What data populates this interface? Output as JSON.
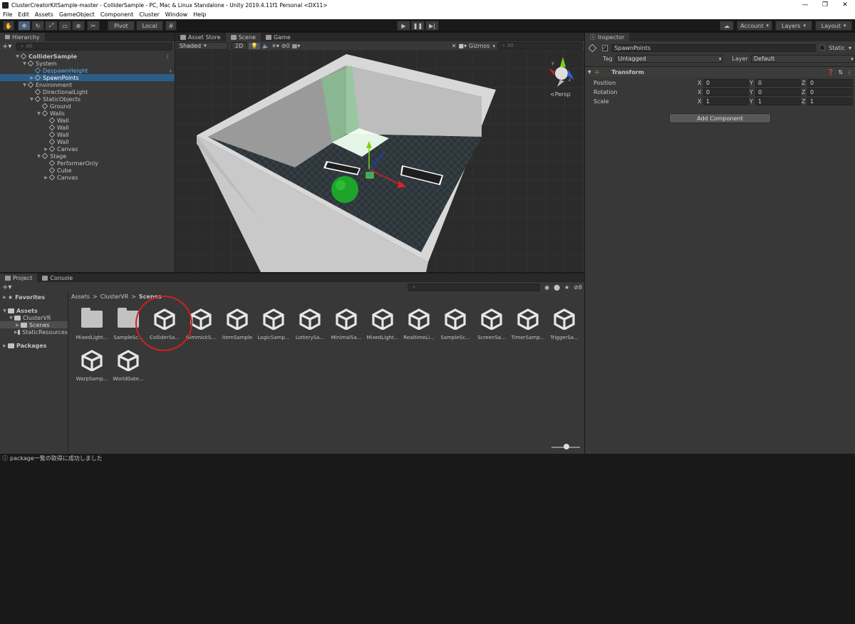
{
  "window": {
    "title": "ClusterCreatorKitSample-master - ColliderSample - PC, Mac & Linux Standalone - Unity 2019.4.11f1 Personal <DX11>",
    "minimize": "—",
    "maximize": "❐",
    "close": "✕"
  },
  "menu": [
    "File",
    "Edit",
    "Assets",
    "GameObject",
    "Component",
    "Cluster",
    "Window",
    "Help"
  ],
  "toolbar": {
    "pivot": "Pivot",
    "local": "Local",
    "account": "Account",
    "layers": "Layers",
    "layout": "Layout"
  },
  "hierarchy": {
    "tab": "Hierarchy",
    "search_placeholder": "All",
    "items": [
      {
        "label": "ColliderSample",
        "depth": 0,
        "arrow": "▼",
        "icon": "scene"
      },
      {
        "label": "System",
        "depth": 1,
        "arrow": "▼",
        "icon": "cube"
      },
      {
        "label": "DespawnHeight",
        "depth": 2,
        "arrow": "",
        "icon": "cube-blue",
        "highlight": true
      },
      {
        "label": "SpawnPoints",
        "depth": 2,
        "arrow": "▶",
        "icon": "cube",
        "selected": true
      },
      {
        "label": "Environment",
        "depth": 1,
        "arrow": "▼",
        "icon": "cube"
      },
      {
        "label": "DirectionalLight",
        "depth": 2,
        "arrow": "",
        "icon": "cube"
      },
      {
        "label": "StaticObjects",
        "depth": 2,
        "arrow": "▼",
        "icon": "cube"
      },
      {
        "label": "Ground",
        "depth": 3,
        "arrow": "",
        "icon": "cube"
      },
      {
        "label": "Walls",
        "depth": 3,
        "arrow": "▼",
        "icon": "cube"
      },
      {
        "label": "Wall",
        "depth": 4,
        "arrow": "",
        "icon": "cube"
      },
      {
        "label": "Wall",
        "depth": 4,
        "arrow": "",
        "icon": "cube"
      },
      {
        "label": "Wall",
        "depth": 4,
        "arrow": "",
        "icon": "cube"
      },
      {
        "label": "Wall",
        "depth": 4,
        "arrow": "",
        "icon": "cube"
      },
      {
        "label": "Canvas",
        "depth": 4,
        "arrow": "▶",
        "icon": "cube"
      },
      {
        "label": "Stage",
        "depth": 3,
        "arrow": "▼",
        "icon": "cube"
      },
      {
        "label": "PerformerOnly",
        "depth": 4,
        "arrow": "",
        "icon": "cube"
      },
      {
        "label": "Cube",
        "depth": 4,
        "arrow": "",
        "icon": "cube"
      },
      {
        "label": "Canvas",
        "depth": 4,
        "arrow": "▶",
        "icon": "cube"
      }
    ]
  },
  "scene": {
    "tabs": [
      "Asset Store",
      "Scene",
      "Game"
    ],
    "active_tab": "Scene",
    "shading": "Shaded",
    "mode_2d": "2D",
    "hidden_count": "0",
    "gizmos": "Gizmos",
    "search_placeholder": "All",
    "persp": "Persp"
  },
  "inspector": {
    "tab": "Inspector",
    "object_name": "SpawnPoints",
    "static_label": "Static",
    "tag_label": "Tag",
    "tag_value": "Untagged",
    "layer_label": "Layer",
    "layer_value": "Default",
    "component": "Transform",
    "rows": [
      {
        "label": "Position",
        "x": "0",
        "y": "0",
        "z": "0"
      },
      {
        "label": "Rotation",
        "x": "0",
        "y": "0",
        "z": "0"
      },
      {
        "label": "Scale",
        "x": "1",
        "y": "1",
        "z": "1"
      }
    ],
    "axis": {
      "x": "X",
      "y": "Y",
      "z": "Z"
    },
    "add_component": "Add Component"
  },
  "project": {
    "tabs": [
      "Project",
      "Console"
    ],
    "tree": [
      {
        "label": "Favorites",
        "depth": 0,
        "arrow": "▶",
        "icon": "star"
      },
      {
        "label": "Assets",
        "depth": 0,
        "arrow": "▼",
        "icon": "folder"
      },
      {
        "label": "ClusterVR",
        "depth": 1,
        "arrow": "▼",
        "icon": "folder"
      },
      {
        "label": "Scenes",
        "depth": 2,
        "arrow": "▶",
        "icon": "folder",
        "selected": true
      },
      {
        "label": "StaticResources",
        "depth": 2,
        "arrow": "▶",
        "icon": "folder"
      },
      {
        "label": "Packages",
        "depth": 0,
        "arrow": "▶",
        "icon": "folder"
      }
    ],
    "breadcrumb": [
      "Assets",
      "ClusterVR",
      "Scenes"
    ],
    "hidden_count": "8",
    "assets": [
      {
        "label": "MixedLight...",
        "type": "folder"
      },
      {
        "label": "SampleSc...",
        "type": "folder"
      },
      {
        "label": "ColliderSa...",
        "type": "unity"
      },
      {
        "label": "GimmickS...",
        "type": "unity"
      },
      {
        "label": "ItemSample",
        "type": "unity"
      },
      {
        "label": "LogicSamp...",
        "type": "unity"
      },
      {
        "label": "LotterySa...",
        "type": "unity"
      },
      {
        "label": "MinimalSa...",
        "type": "unity"
      },
      {
        "label": "MixedLight...",
        "type": "unity"
      },
      {
        "label": "RealtimeLi...",
        "type": "unity"
      },
      {
        "label": "SampleSc...",
        "type": "unity"
      },
      {
        "label": "ScreenSa...",
        "type": "unity"
      },
      {
        "label": "TimerSamp...",
        "type": "unity"
      },
      {
        "label": "TriggerSa...",
        "type": "unity"
      },
      {
        "label": "WarpSamp...",
        "type": "unity"
      },
      {
        "label": "WorldGate...",
        "type": "unity"
      }
    ],
    "highlight_color": "#d02020"
  },
  "status_text": "package一覧の取得に成功しました",
  "colors": {
    "selection": "#2c5d87",
    "hierarchy_highlight": "#5cb3ff"
  }
}
